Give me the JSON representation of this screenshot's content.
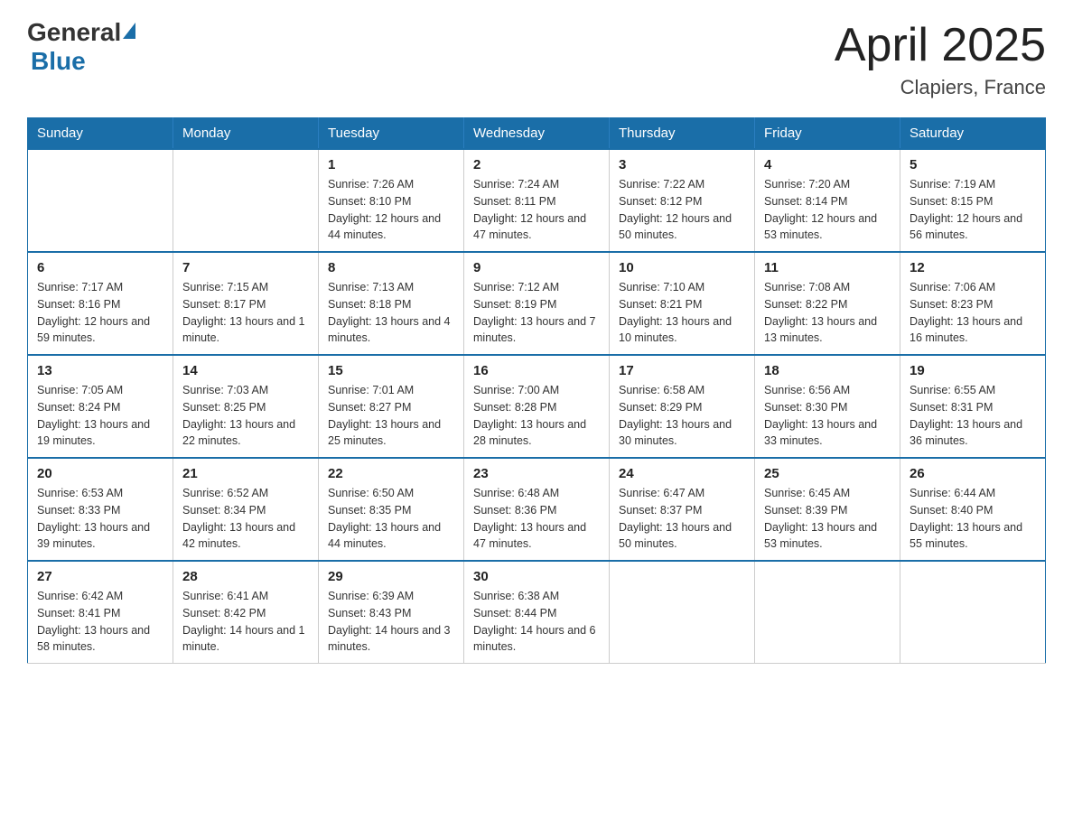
{
  "logo": {
    "general": "General",
    "blue": "Blue"
  },
  "title": {
    "month_year": "April 2025",
    "location": "Clapiers, France"
  },
  "weekdays": [
    "Sunday",
    "Monday",
    "Tuesday",
    "Wednesday",
    "Thursday",
    "Friday",
    "Saturday"
  ],
  "weeks": [
    [
      {
        "day": "",
        "info": ""
      },
      {
        "day": "",
        "info": ""
      },
      {
        "day": "1",
        "info": "Sunrise: 7:26 AM\nSunset: 8:10 PM\nDaylight: 12 hours\nand 44 minutes."
      },
      {
        "day": "2",
        "info": "Sunrise: 7:24 AM\nSunset: 8:11 PM\nDaylight: 12 hours\nand 47 minutes."
      },
      {
        "day": "3",
        "info": "Sunrise: 7:22 AM\nSunset: 8:12 PM\nDaylight: 12 hours\nand 50 minutes."
      },
      {
        "day": "4",
        "info": "Sunrise: 7:20 AM\nSunset: 8:14 PM\nDaylight: 12 hours\nand 53 minutes."
      },
      {
        "day": "5",
        "info": "Sunrise: 7:19 AM\nSunset: 8:15 PM\nDaylight: 12 hours\nand 56 minutes."
      }
    ],
    [
      {
        "day": "6",
        "info": "Sunrise: 7:17 AM\nSunset: 8:16 PM\nDaylight: 12 hours\nand 59 minutes."
      },
      {
        "day": "7",
        "info": "Sunrise: 7:15 AM\nSunset: 8:17 PM\nDaylight: 13 hours\nand 1 minute."
      },
      {
        "day": "8",
        "info": "Sunrise: 7:13 AM\nSunset: 8:18 PM\nDaylight: 13 hours\nand 4 minutes."
      },
      {
        "day": "9",
        "info": "Sunrise: 7:12 AM\nSunset: 8:19 PM\nDaylight: 13 hours\nand 7 minutes."
      },
      {
        "day": "10",
        "info": "Sunrise: 7:10 AM\nSunset: 8:21 PM\nDaylight: 13 hours\nand 10 minutes."
      },
      {
        "day": "11",
        "info": "Sunrise: 7:08 AM\nSunset: 8:22 PM\nDaylight: 13 hours\nand 13 minutes."
      },
      {
        "day": "12",
        "info": "Sunrise: 7:06 AM\nSunset: 8:23 PM\nDaylight: 13 hours\nand 16 minutes."
      }
    ],
    [
      {
        "day": "13",
        "info": "Sunrise: 7:05 AM\nSunset: 8:24 PM\nDaylight: 13 hours\nand 19 minutes."
      },
      {
        "day": "14",
        "info": "Sunrise: 7:03 AM\nSunset: 8:25 PM\nDaylight: 13 hours\nand 22 minutes."
      },
      {
        "day": "15",
        "info": "Sunrise: 7:01 AM\nSunset: 8:27 PM\nDaylight: 13 hours\nand 25 minutes."
      },
      {
        "day": "16",
        "info": "Sunrise: 7:00 AM\nSunset: 8:28 PM\nDaylight: 13 hours\nand 28 minutes."
      },
      {
        "day": "17",
        "info": "Sunrise: 6:58 AM\nSunset: 8:29 PM\nDaylight: 13 hours\nand 30 minutes."
      },
      {
        "day": "18",
        "info": "Sunrise: 6:56 AM\nSunset: 8:30 PM\nDaylight: 13 hours\nand 33 minutes."
      },
      {
        "day": "19",
        "info": "Sunrise: 6:55 AM\nSunset: 8:31 PM\nDaylight: 13 hours\nand 36 minutes."
      }
    ],
    [
      {
        "day": "20",
        "info": "Sunrise: 6:53 AM\nSunset: 8:33 PM\nDaylight: 13 hours\nand 39 minutes."
      },
      {
        "day": "21",
        "info": "Sunrise: 6:52 AM\nSunset: 8:34 PM\nDaylight: 13 hours\nand 42 minutes."
      },
      {
        "day": "22",
        "info": "Sunrise: 6:50 AM\nSunset: 8:35 PM\nDaylight: 13 hours\nand 44 minutes."
      },
      {
        "day": "23",
        "info": "Sunrise: 6:48 AM\nSunset: 8:36 PM\nDaylight: 13 hours\nand 47 minutes."
      },
      {
        "day": "24",
        "info": "Sunrise: 6:47 AM\nSunset: 8:37 PM\nDaylight: 13 hours\nand 50 minutes."
      },
      {
        "day": "25",
        "info": "Sunrise: 6:45 AM\nSunset: 8:39 PM\nDaylight: 13 hours\nand 53 minutes."
      },
      {
        "day": "26",
        "info": "Sunrise: 6:44 AM\nSunset: 8:40 PM\nDaylight: 13 hours\nand 55 minutes."
      }
    ],
    [
      {
        "day": "27",
        "info": "Sunrise: 6:42 AM\nSunset: 8:41 PM\nDaylight: 13 hours\nand 58 minutes."
      },
      {
        "day": "28",
        "info": "Sunrise: 6:41 AM\nSunset: 8:42 PM\nDaylight: 14 hours\nand 1 minute."
      },
      {
        "day": "29",
        "info": "Sunrise: 6:39 AM\nSunset: 8:43 PM\nDaylight: 14 hours\nand 3 minutes."
      },
      {
        "day": "30",
        "info": "Sunrise: 6:38 AM\nSunset: 8:44 PM\nDaylight: 14 hours\nand 6 minutes."
      },
      {
        "day": "",
        "info": ""
      },
      {
        "day": "",
        "info": ""
      },
      {
        "day": "",
        "info": ""
      }
    ]
  ]
}
